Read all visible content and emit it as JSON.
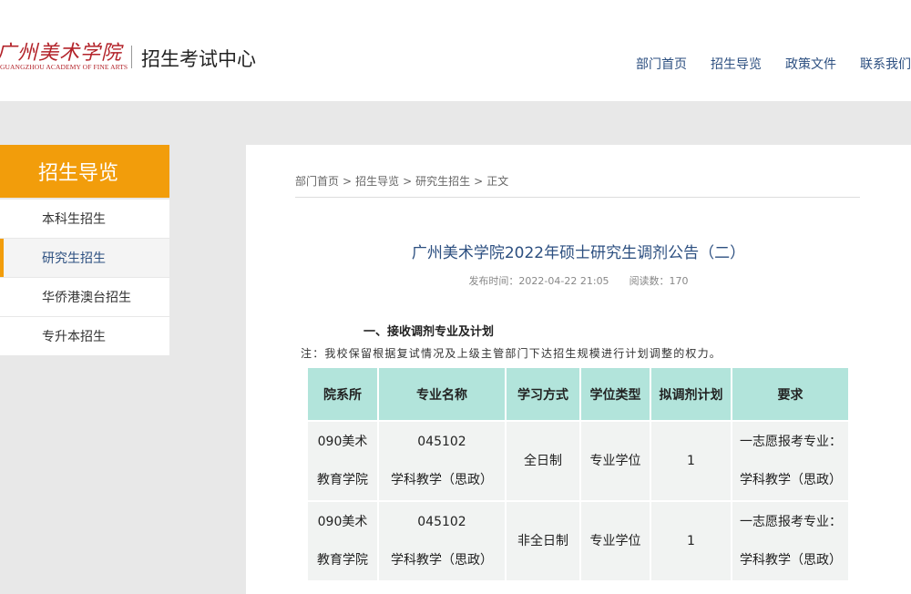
{
  "header": {
    "logo_cn": "广州美术学院",
    "logo_en": "GUANGZHOU ACADEMY OF FINE ARTS",
    "site_title": "招生考试中心",
    "nav": [
      "部门首页",
      "招生导览",
      "政策文件",
      "联系我们"
    ]
  },
  "sidebar": {
    "title": "招生导览",
    "items": [
      {
        "label": "本科生招生"
      },
      {
        "label": "研究生招生"
      },
      {
        "label": "华侨港澳台招生"
      },
      {
        "label": "专升本招生"
      }
    ],
    "active_index": 1
  },
  "breadcrumb": {
    "items": [
      "部门首页",
      "招生导览",
      "研究生招生",
      "正文"
    ],
    "separator": ">"
  },
  "article": {
    "title": "广州美术学院2022年硕士研究生调剂公告（二）",
    "publish_time": "发布时间：2022-04-22 21:05",
    "read_count": "阅读数：170",
    "section_heading": "一、接收调剂专业及计划",
    "note": "注：我校保留根据复试情况及上级主管部门下达招生规模进行计划调整的权力。"
  },
  "table": {
    "headers": [
      "院系所",
      "专业名称",
      "学习方式",
      "学位类型",
      "拟调剂计划",
      "要求"
    ],
    "rows": [
      {
        "dept": [
          "090美术",
          "教育学院"
        ],
        "major": [
          "045102",
          "学科教学（思政）"
        ],
        "mode": "全日制",
        "degree": "专业学位",
        "plan": "1",
        "req": [
          "一志愿报考专业：",
          "学科教学（思政）"
        ]
      },
      {
        "dept": [
          "090美术",
          "教育学院"
        ],
        "major": [
          "045102",
          "学科教学（思政）"
        ],
        "mode": "非全日制",
        "degree": "专业学位",
        "plan": "1",
        "req": [
          "一志愿报考专业：",
          "学科教学（思政）"
        ]
      }
    ]
  },
  "colors": {
    "accent_orange": "#f29d0b",
    "link_blue": "#2c4f80",
    "table_header_bg": "#b2e4db",
    "logo_red": "#b3232a"
  }
}
